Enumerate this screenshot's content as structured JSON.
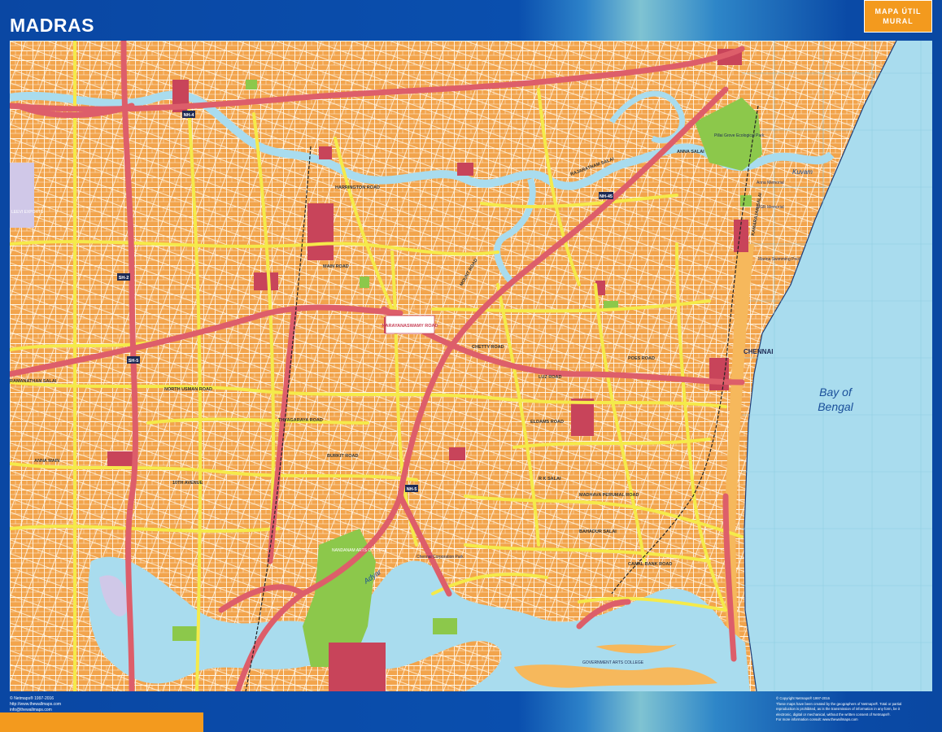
{
  "header": {
    "title": "MADRAS",
    "brand_line1": "MAPA ÚTIL",
    "brand_line2": "MURAL"
  },
  "map": {
    "sea_label_line1": "Bay of",
    "sea_label_line2": "Bengal",
    "city_label": "CHENNAI",
    "river_label": "Adyar",
    "kovam_label": "Kuvam",
    "park_labels": [
      "Pillai Grove Ecological Park"
    ],
    "roads": [
      "RAJARATNAM SALAI",
      "HARRINGTON ROAD",
      "ANNA SALAI",
      "MOUNT ROAD",
      "CHETTY ROAD",
      "THYAGARAYA ROAD",
      "BURKIT ROAD",
      "ANNA MAIN",
      "10TH AVENUE",
      "MAIN ROAD",
      "RAMANATHAN SALAI",
      "NORTH USMAN ROAD",
      "POES ROAD",
      "KAMARAJAR SALAI",
      "ELDAMS ROAD",
      "BAHADUR SALAI",
      "CANAL BANK ROAD",
      "LUZ ROAD",
      "MADHAVA PERUMAL ROAD",
      "R K SALAI"
    ],
    "places": [
      "LEEVI EXPORTS",
      "NANDANAM ARTS COLLEGE",
      "GOVERNMENT ARTS COLLEGE",
      "Chennai Corporation Park",
      "Marina Swimming Pool",
      "Anna Memorial",
      "MGR Memorial",
      "NARAYANASWAMY ROAD"
    ],
    "route_shields": [
      "NH-4",
      "NH-45",
      "SH-2",
      "SH-5",
      "NH-5"
    ],
    "colors": {
      "sea": "#a9dcee",
      "land": "#f2a44c",
      "major_road": "#dd5e6a",
      "minor_road": "#f5ea4a",
      "street": "#ffffff",
      "park": "#8cc84b",
      "institution": "#c8445a",
      "river": "#a9dcee",
      "sand": "#f6b85c"
    }
  },
  "footer": {
    "left": [
      "© Netmaps® 1997-2016",
      "http://www.thewallmaps.com",
      "info@thewallmaps.com"
    ],
    "right": [
      "© Copyright Netmaps® 1997-2016",
      "These maps have been created by the geographers of Netmaps®. Total or partial",
      "reproduction is prohibited, as is the transmission of information in any form, be it",
      "electronic, digital or mechanical, without the written consent of Netmaps®.",
      "For more information consult: www.thewallmaps.com"
    ]
  }
}
